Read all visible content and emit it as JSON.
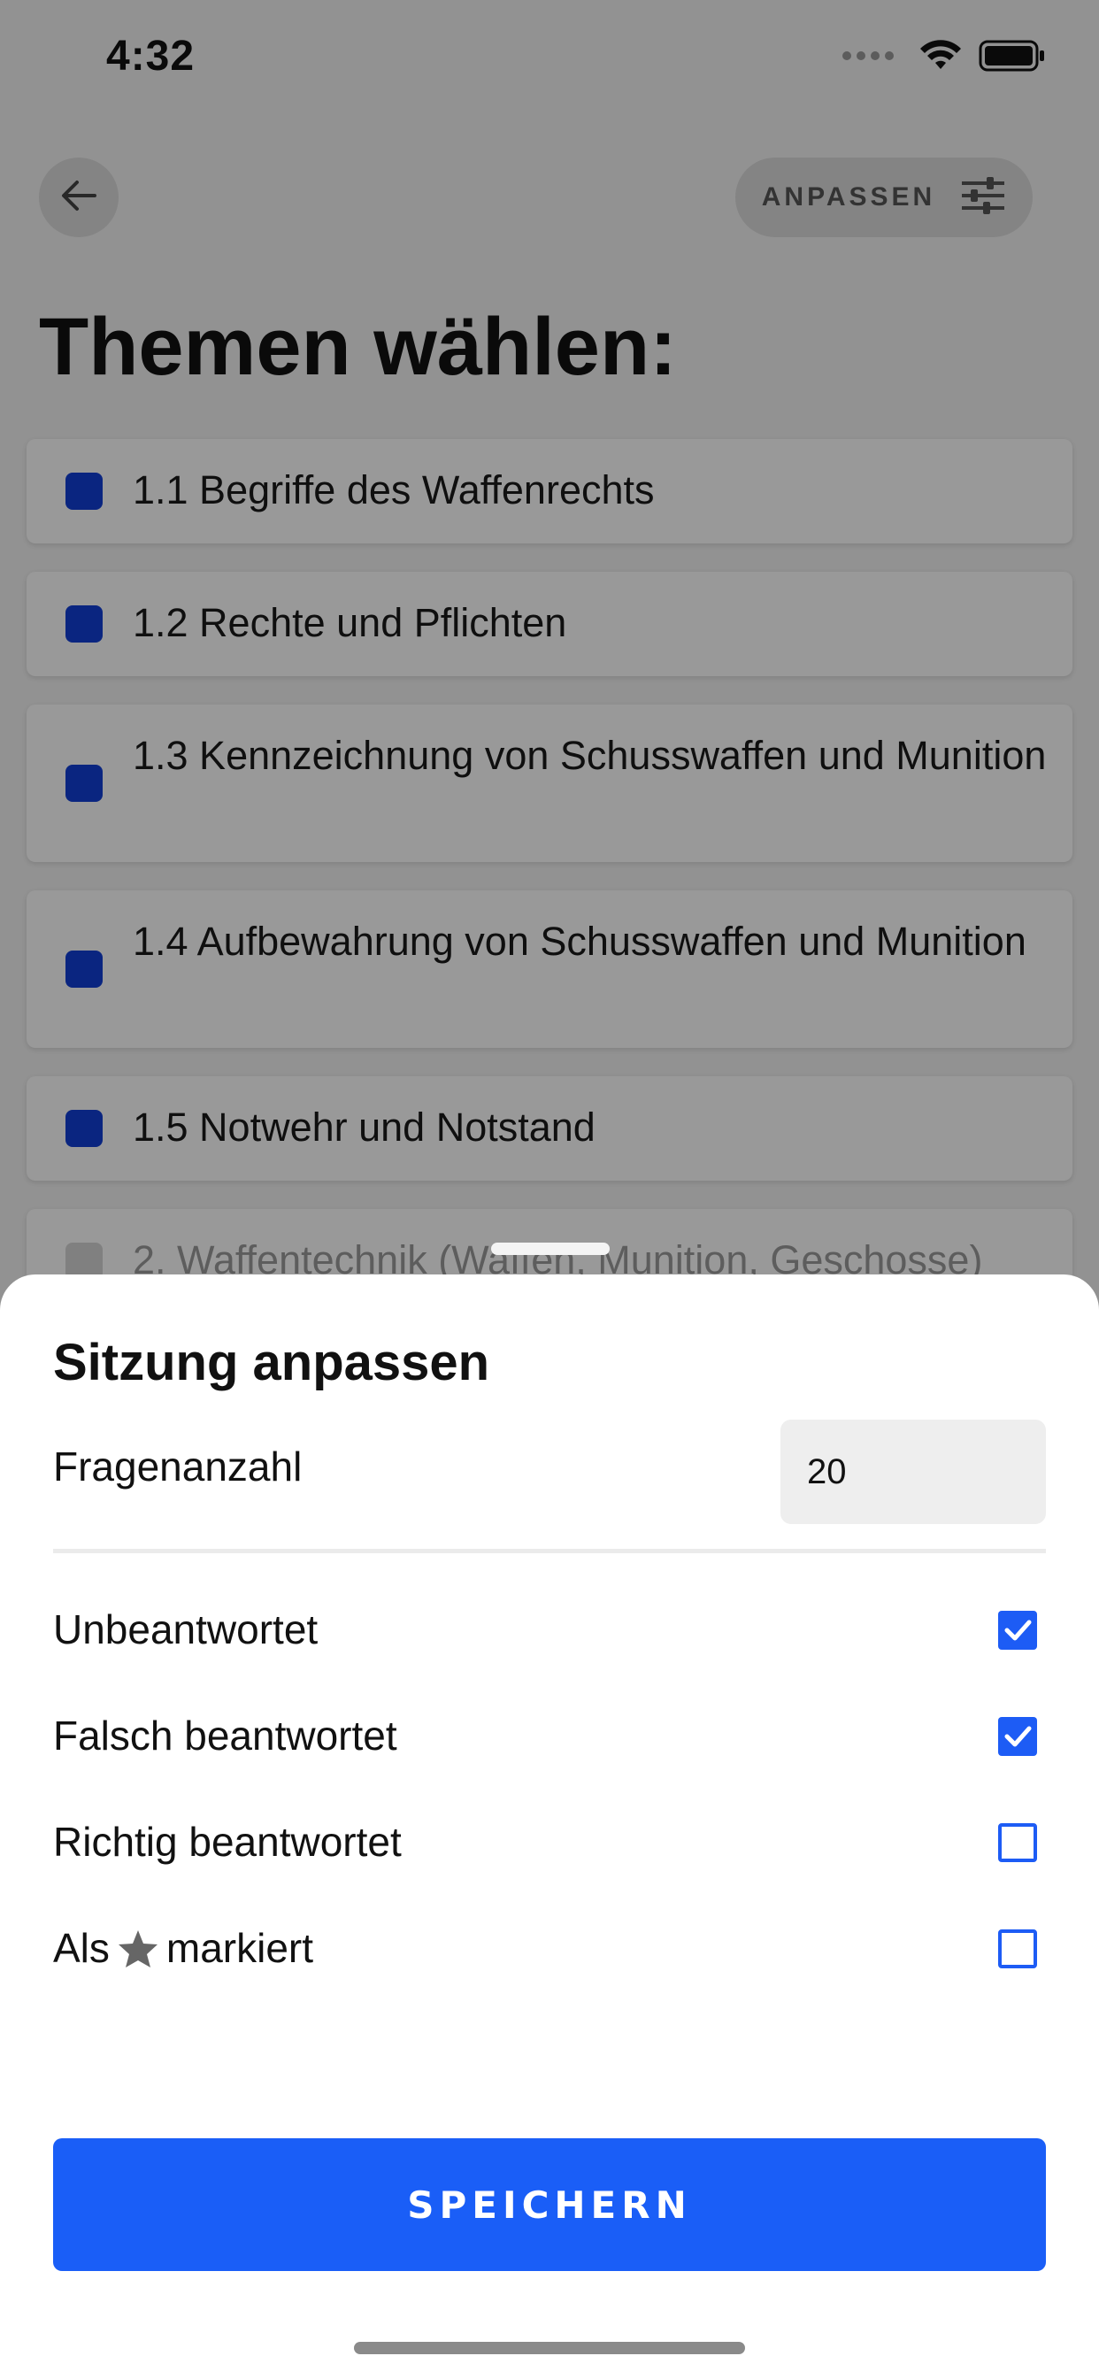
{
  "status_bar": {
    "time": "4:32"
  },
  "header": {
    "back_icon": "arrow-left-icon",
    "adjust_label": "ANPASSEN",
    "adjust_icon": "sliders-icon"
  },
  "page": {
    "title": "Themen wählen:"
  },
  "topics": [
    {
      "label": "1.1 Begriffe des Waffenrechts",
      "selected": true
    },
    {
      "label": "1.2 Rechte und Pflichten",
      "selected": true
    },
    {
      "label": "1.3 Kennzeichnung von Schusswaffen und Munition",
      "selected": true
    },
    {
      "label": "1.4 Aufbewahrung von Schusswaffen und Munition",
      "selected": true
    },
    {
      "label": "1.5 Notwehr und Notstand",
      "selected": true
    },
    {
      "label": "2. Waffentechnik (Waffen, Munition, Geschosse)",
      "selected": false
    }
  ],
  "sheet": {
    "title": "Sitzung anpassen",
    "question_count_label": "Fragenanzahl",
    "question_count_value": "20",
    "filters": [
      {
        "label": "Unbeantwortet",
        "checked": true
      },
      {
        "label": "Falsch beantwortet",
        "checked": true
      },
      {
        "label": "Richtig beantwortet",
        "checked": false
      },
      {
        "label_before": "Als",
        "icon": "star-icon",
        "label_after": "markiert",
        "checked": false
      }
    ],
    "save_label": "SPEICHERN"
  },
  "colors": {
    "accent": "#1a5ef7",
    "topic_checkbox": "#123fd6"
  }
}
